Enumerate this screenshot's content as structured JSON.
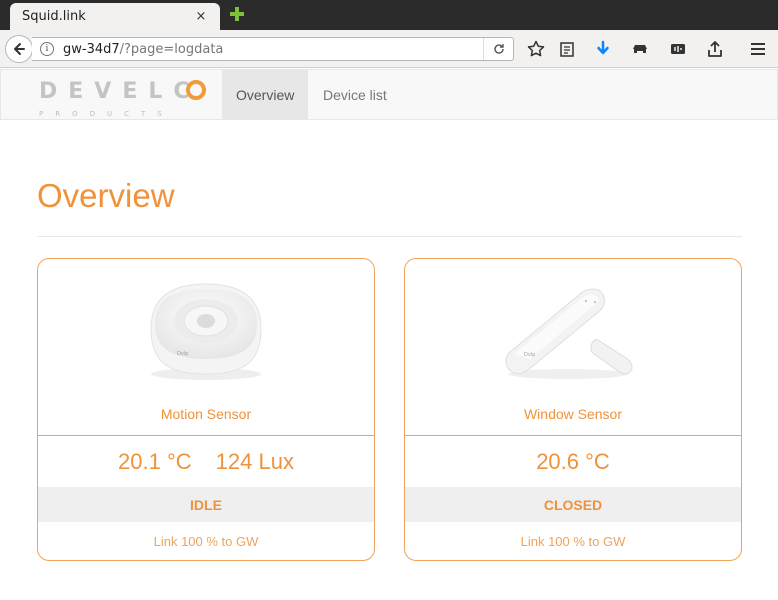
{
  "browser": {
    "tab_title": "Squid.link",
    "tab_close_glyph": "×",
    "url_host": "gw-34d7",
    "url_path": "/?page=logdata",
    "icons": [
      "back-arrow-icon",
      "info-icon",
      "reload-icon",
      "star-icon",
      "reading-list-icon",
      "download-icon",
      "pocket-icon",
      "screenshot-icon",
      "share-icon",
      "menu-icon"
    ]
  },
  "site": {
    "logo_text": "DEVELCO",
    "logo_subtext": "PRODUCTS",
    "nav": [
      {
        "label": "Overview",
        "active": true
      },
      {
        "label": "Device list",
        "active": false
      }
    ]
  },
  "main": {
    "title": "Overview",
    "devices": [
      {
        "name": "Motion Sensor",
        "temperature": "20.1 °C",
        "lux": "124 Lux",
        "state": "IDLE",
        "link": "Link 100 % to GW",
        "image": "motion-sensor-image"
      },
      {
        "name": "Window Sensor",
        "temperature": "20.6 °C",
        "state": "CLOSED",
        "link": "Link 100 % to GW",
        "image": "window-sensor-image"
      }
    ]
  },
  "colors": {
    "accent": "#f0923a",
    "card_border": "#f0a35a",
    "tabbar": "#2b2b2b",
    "nav_bg": "#f8f8f8"
  }
}
